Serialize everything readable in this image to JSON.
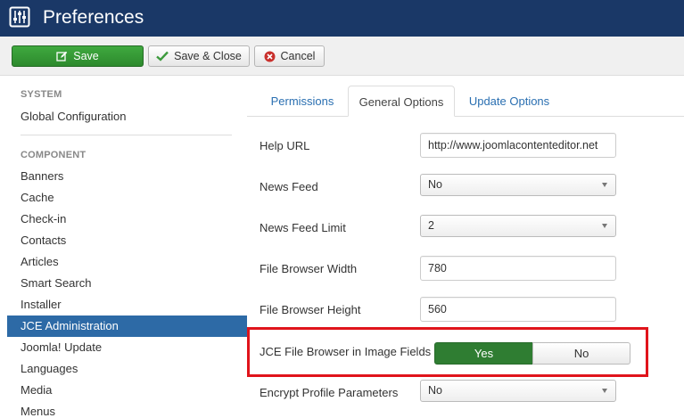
{
  "header": {
    "title": "Preferences",
    "icon": "sliders-icon",
    "background": "#1a3867"
  },
  "toolbar": {
    "save_label": "Save",
    "save_close_label": "Save & Close",
    "cancel_label": "Cancel"
  },
  "sidebar": {
    "system_heading": "SYSTEM",
    "global_config": "Global Configuration",
    "component_heading": "COMPONENT",
    "items": [
      "Banners",
      "Cache",
      "Check-in",
      "Contacts",
      "Articles",
      "Smart Search",
      "Installer",
      "JCE Administration",
      "Joomla! Update",
      "Languages",
      "Media",
      "Menus"
    ],
    "active_item": "JCE Administration",
    "active_color": "#2d6aa6"
  },
  "tabs": {
    "permissions": "Permissions",
    "general": "General Options",
    "update": "Update Options",
    "active": "General Options"
  },
  "form": {
    "help_url": {
      "label": "Help URL",
      "value": "http://www.joomlacontenteditor.net"
    },
    "news_feed": {
      "label": "News Feed",
      "value": "No"
    },
    "news_feed_limit": {
      "label": "News Feed Limit",
      "value": "2"
    },
    "fb_width": {
      "label": "File Browser Width",
      "value": "780"
    },
    "fb_height": {
      "label": "File Browser Height",
      "value": "560"
    },
    "jce_image_fields": {
      "label": "JCE File Browser in Image Fields",
      "yes": "Yes",
      "no": "No",
      "selected": "Yes"
    },
    "encrypt_profile": {
      "label": "Encrypt Profile Parameters",
      "value": "No"
    }
  },
  "colors": {
    "save_green": "#2d8a2d",
    "toggle_yes_green": "#2f7d32",
    "highlight_red": "#e0141b",
    "link_blue": "#2a6fb1"
  }
}
